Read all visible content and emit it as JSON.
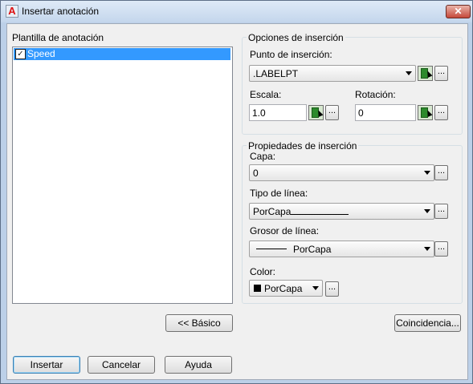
{
  "window": {
    "title": "Insertar anotación",
    "close_glyph": "✕",
    "app_icon": "A"
  },
  "template_list": {
    "label": "Plantilla de anotación",
    "items": [
      {
        "label": "Speed",
        "checked": true,
        "check_glyph": "✓"
      }
    ]
  },
  "insertion_options": {
    "group_title": "Opciones de inserción",
    "insertion_point_label": "Punto de inserción:",
    "insertion_point_value": ".LABELPT",
    "scale_label": "Escala:",
    "scale_value": "1.0",
    "rotation_label": "Rotación:",
    "rotation_value": "0",
    "ellipsis": "..."
  },
  "insertion_properties": {
    "group_title": "Propiedades de inserción",
    "layer_label": "Capa:",
    "layer_value": "0",
    "linetype_label": "Tipo de línea:",
    "linetype_value": "PorCapa",
    "lineweight_label": "Grosor de línea:",
    "lineweight_value": "PorCapa",
    "color_label": "Color:",
    "color_value": "PorCapa",
    "color_swatch": "#000000"
  },
  "buttons": {
    "basic": "<< Básico",
    "match": "Coincidencia...",
    "insert": "Insertar",
    "cancel": "Cancelar",
    "help": "Ayuda"
  },
  "colors": {
    "selection": "#3399ff",
    "pick_green": "#2c8a2c"
  }
}
